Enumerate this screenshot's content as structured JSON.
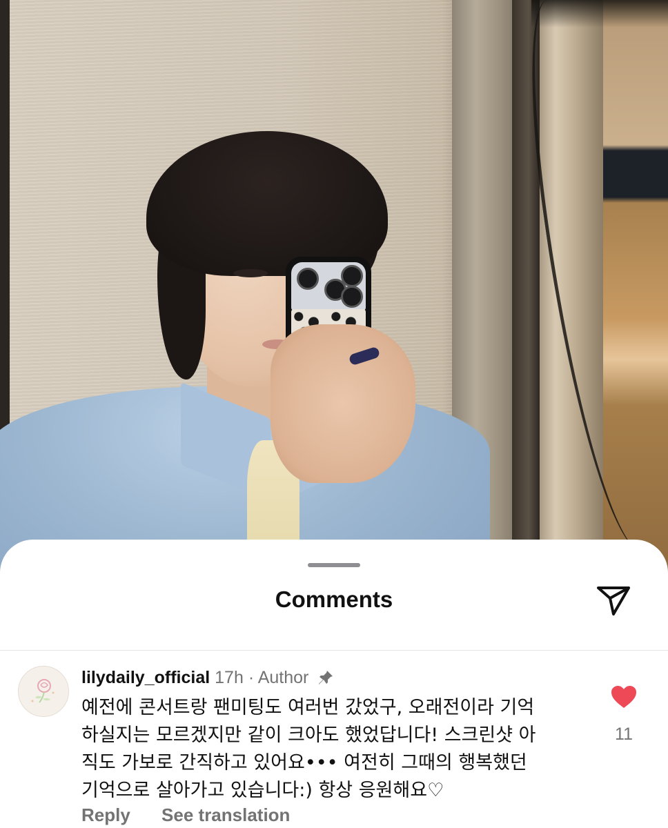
{
  "sheet": {
    "title": "Comments"
  },
  "comment": {
    "username": "lilydaily_official",
    "time": "17h",
    "separator": "·",
    "role": "Author",
    "text_lines": [
      "예전에 콘서트랑 팬미팅도 여러번 갔었구, 오래전이라 기억",
      "하실지는 모르겠지만 같이 크아도 했었답니다! 스크린샷 아",
      "직도 가보로 간직하고 있어요••• 여전히 그때의 행복했던",
      "기억으로 살아가고 있습니다:) 항상 응원해요♡"
    ],
    "likes": "11",
    "reply_label": "Reply",
    "translate_label": "See translation",
    "liked": true
  },
  "icons": {
    "share": "paper-plane-icon",
    "pin": "pin-icon",
    "like": "heart-icon"
  },
  "colors": {
    "heart": "#ED4956",
    "secondary_text": "#737373",
    "primary_text": "#111111"
  }
}
